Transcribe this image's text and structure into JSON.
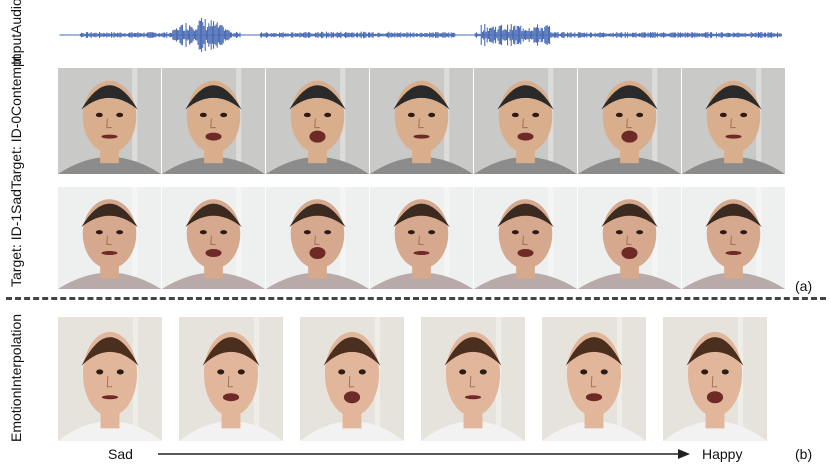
{
  "rows": {
    "audio": {
      "label_line1": "Input",
      "label_line2": "Audio",
      "wave_color": "#3b5fb0"
    },
    "row_id0": {
      "label_line1": "Target: ID-0",
      "label_line2": "Contempt",
      "bg": "#c9c9c7",
      "skin": "#d9ae8c",
      "hair": "#2a2a2a",
      "cloth": "#8c8c8c"
    },
    "row_id1": {
      "label_line1": "Target: ID-1",
      "label_line2": "Sad",
      "bg": "#eef0ef",
      "skin": "#d6a98e",
      "hair": "#3a2a20",
      "cloth": "#b7aaa8"
    },
    "row_interp": {
      "label_line1": "Emotion",
      "label_line2": "Interpolation",
      "bg": "#e6e3dc",
      "skin": "#e2b69a",
      "hair": "#4a2f1e",
      "cloth": "#f2f2f2"
    }
  },
  "panel_tags": {
    "a": "(a)",
    "b": "(b)"
  },
  "axis": {
    "start_label": "Sad",
    "end_label": "Happy"
  }
}
